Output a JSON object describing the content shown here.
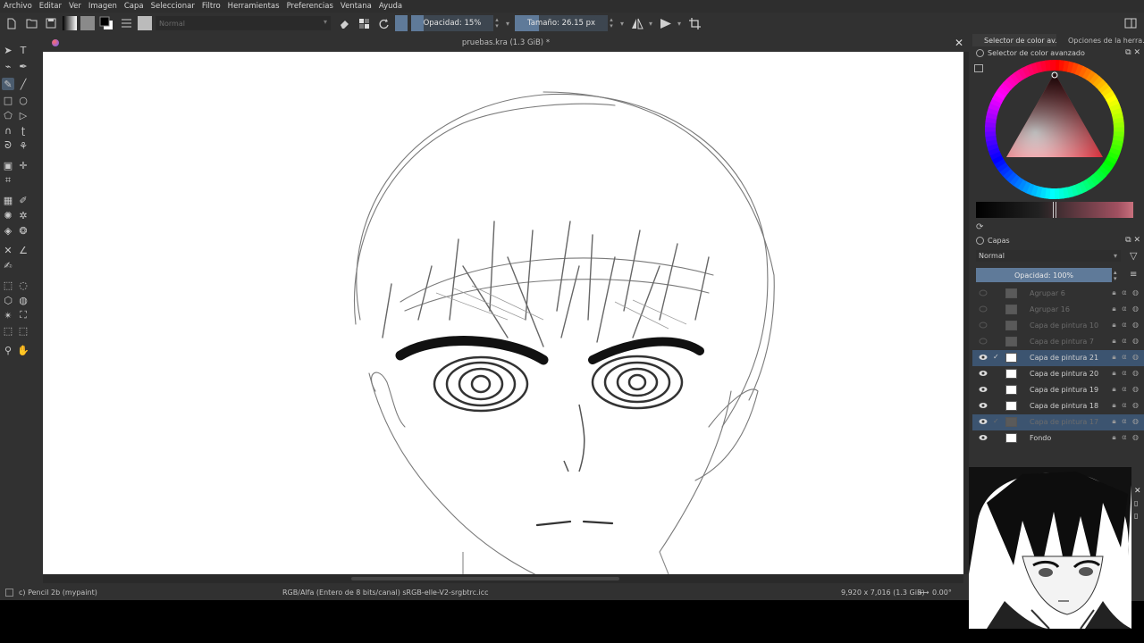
{
  "menu": [
    "Archivo",
    "Editar",
    "Ver",
    "Imagen",
    "Capa",
    "Seleccionar",
    "Filtro",
    "Herramientas",
    "Preferencias",
    "Ventana",
    "Ayuda"
  ],
  "toolbar": {
    "blend_mode": "Normal",
    "opacity_label": "Opacidad: 15%",
    "opacity_value": 0.15,
    "size_label": "Tamaño: 26.15 px",
    "size_fill": 0.26
  },
  "document": {
    "title": "pruebas.kra (1.3 GiB) *"
  },
  "dockers": {
    "tabs": [
      "Selector de color av...",
      "Opciones de la herra..."
    ],
    "color_selector_title": "Selector de color avanzado",
    "layers_title": "Capas",
    "layers_mode": "Normal",
    "layers_opacity_label": "Opacidad:  100%",
    "layers": [
      {
        "name": "Agrupar 6",
        "state": "dim"
      },
      {
        "name": "Agrupar 16",
        "state": "dim"
      },
      {
        "name": "Capa de pintura 10",
        "state": "dim"
      },
      {
        "name": "Capa de pintura 7",
        "state": "dim"
      },
      {
        "name": "Capa de pintura 21",
        "state": "selected"
      },
      {
        "name": "Capa de pintura 20",
        "state": "normal"
      },
      {
        "name": "Capa de pintura 19",
        "state": "normal"
      },
      {
        "name": "Capa de pintura 18",
        "state": "normal"
      },
      {
        "name": "Capa de pintura 17",
        "state": "selected-dim"
      },
      {
        "name": "Fondo",
        "state": "normal"
      }
    ]
  },
  "status": {
    "brush": "c) Pencil 2b (mypaint)",
    "color_space": "RGB/Alfa (Entero de 8 bits/canal)  sRGB-elle-V2-srgbtrc.icc",
    "dimensions": "9,920 x 7,016 (1.3 GiB)",
    "rotation": "0.00°"
  },
  "colors": {
    "accent": "#5f7a99",
    "selection": "#3c5470",
    "panel": "#313131"
  }
}
